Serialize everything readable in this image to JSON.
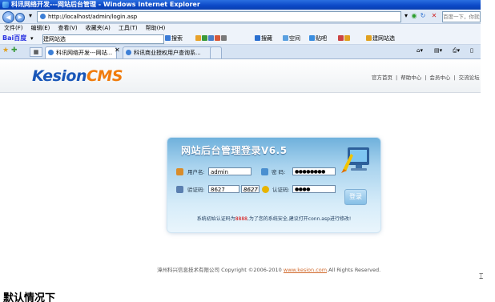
{
  "window": {
    "title": "科讯网络开发---网站后台管理 - Windows Internet Explorer"
  },
  "address_bar": {
    "url": "http://localhost/admin/login.asp",
    "search_placeholder": "百度一下，你就知道"
  },
  "menu": [
    "文件(F)",
    "编辑(E)",
    "查看(V)",
    "收藏夹(A)",
    "工具(T)",
    "帮助(H)"
  ],
  "baidu_toolbar": {
    "logo": "Bai百度",
    "input_value": "建网站选",
    "items": [
      "搜索",
      "搜藏",
      "空间",
      "贴吧",
      "建网站选"
    ]
  },
  "tabs": [
    {
      "label": "科讯网络开发---网站..."
    },
    {
      "label": "科讯商业授权用户查询系..."
    }
  ],
  "site": {
    "logo_k": "Kesion",
    "logo_c": "CMS",
    "top_links": [
      "官方首页",
      "|",
      "帮助中心",
      "|",
      "会员中心",
      "|",
      "交流论坛"
    ]
  },
  "login": {
    "title": "网站后台管理登录V6.5",
    "username_label": "用户名:",
    "username_value": "admin",
    "password_label": "密  码:",
    "password_value": "●●●●●●●●",
    "verify_label": "验证码:",
    "verify_value": "8627",
    "verify_image": "8627",
    "auth_label": "认证码:",
    "auth_value": "●●●●",
    "button": "登录",
    "notice_pre": "系统初始认证码为",
    "notice_code": "8888",
    "notice_post": ",为了您的系统安全,建议打开conn.asp进行修改!"
  },
  "footer": {
    "text": "漳州科兴信息技术有限公司  Copyright ©2006-2010 ",
    "link": "www.kesion.com",
    "suffix": ".All Rights Reserved."
  },
  "bottom_text": "默认情况下"
}
